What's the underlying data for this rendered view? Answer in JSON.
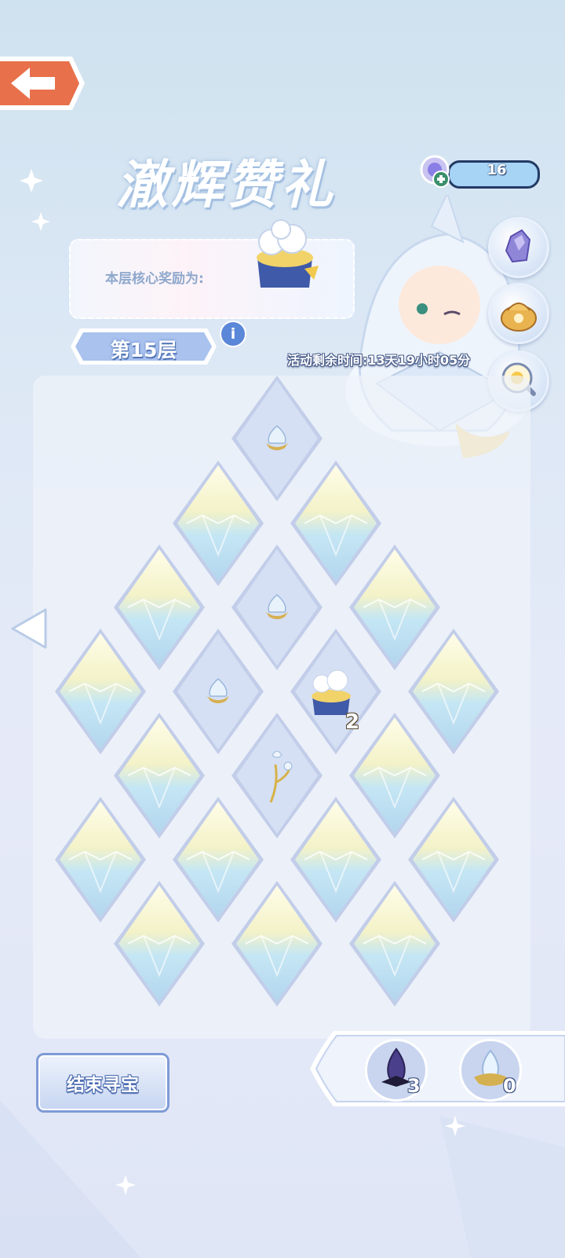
{
  "header": {
    "title": "澈辉赞礼",
    "currency_value": "16"
  },
  "reward": {
    "label": "本层核心奖励为:"
  },
  "floor": {
    "label": "第15层"
  },
  "timer": {
    "text": "活动剩余时间:13天19小时05分"
  },
  "board": {
    "gift_tile_count": "2"
  },
  "footer": {
    "end_button_label": "结束寻宝",
    "dark_crystal_count": "3",
    "light_crystal_count": "0"
  },
  "colors": {
    "accent_orange": "#e8704b",
    "accent_blue": "#5b87d8",
    "panel": "#eef2fa"
  }
}
